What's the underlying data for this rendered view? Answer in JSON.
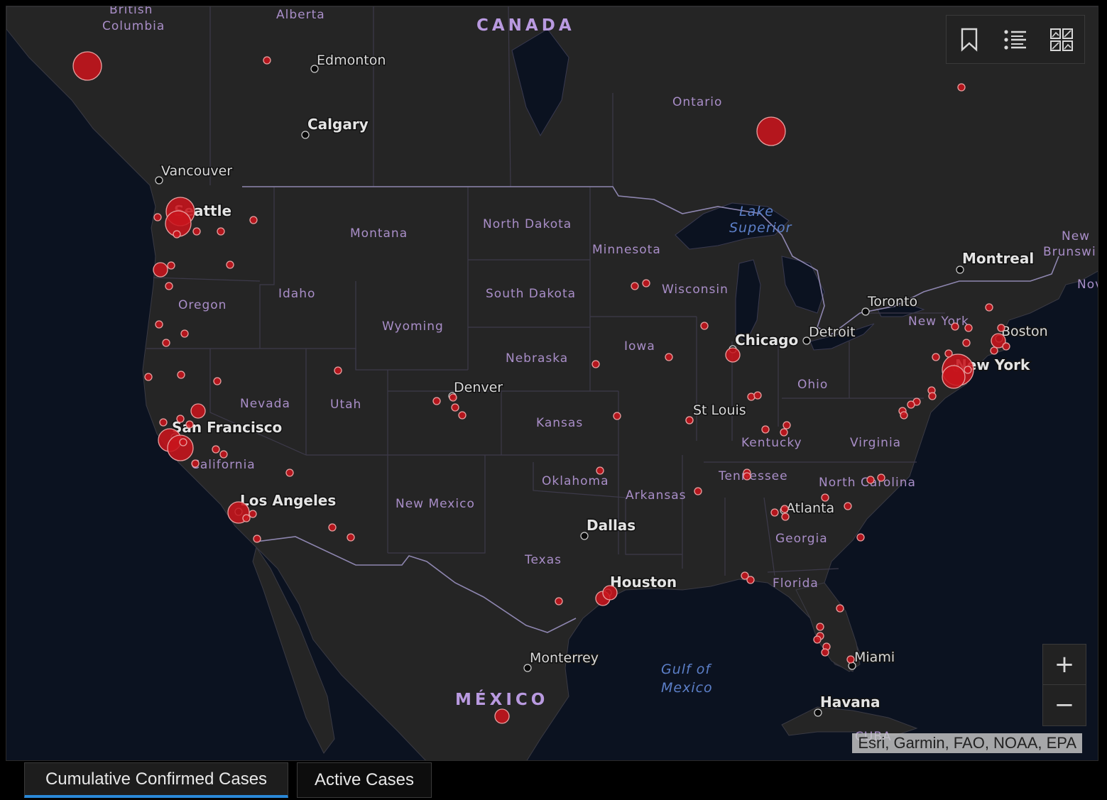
{
  "map": {
    "country_labels": [
      "CANADA",
      "MÉXICO"
    ],
    "region_labels": [
      "British",
      "Columbia",
      "Alberta",
      "Ontario",
      "Montana",
      "North Dakota",
      "Minnesota",
      "South Dakota",
      "Wisconsin",
      "Idaho",
      "Oregon",
      "Wyoming",
      "Iowa",
      "Nebraska",
      "Nevada",
      "Utah",
      "Ohio",
      "Kansas",
      "Kentucky",
      "Virginia",
      "California",
      "Oklahoma",
      "Arkansas",
      "Tennessee",
      "North Carolina",
      "New Mexico",
      "Georgia",
      "Texas",
      "Florida",
      "New York",
      "New",
      "Brunswi",
      "Nov",
      "CUBA"
    ],
    "water_labels": [
      "Lake",
      "Superior",
      "Gulf of",
      "Mexico"
    ],
    "city_labels": [
      "Edmonton",
      "Calgary",
      "Vancouver",
      "Seattle",
      "Montreal",
      "Toronto",
      "Detroit",
      "Chicago",
      "Boston",
      "New York",
      "Denver",
      "St Louis",
      "San Francisco",
      "Los Angeles",
      "Atlanta",
      "Dallas",
      "Houston",
      "Monterrey",
      "Miami",
      "Havana"
    ],
    "case_marker_color": "#c8141c"
  },
  "toolbar": {
    "bookmark_icon": "bookmark-icon",
    "legend_icon": "legend-list-icon",
    "basemap_icon": "basemap-gallery-icon"
  },
  "zoom": {
    "in_label": "+",
    "out_label": "−"
  },
  "attribution": "Esri, Garmin, FAO, NOAA, EPA",
  "tabs": [
    {
      "label": "Cumulative Confirmed Cases",
      "active": true
    },
    {
      "label": "Active Cases",
      "active": false
    }
  ]
}
